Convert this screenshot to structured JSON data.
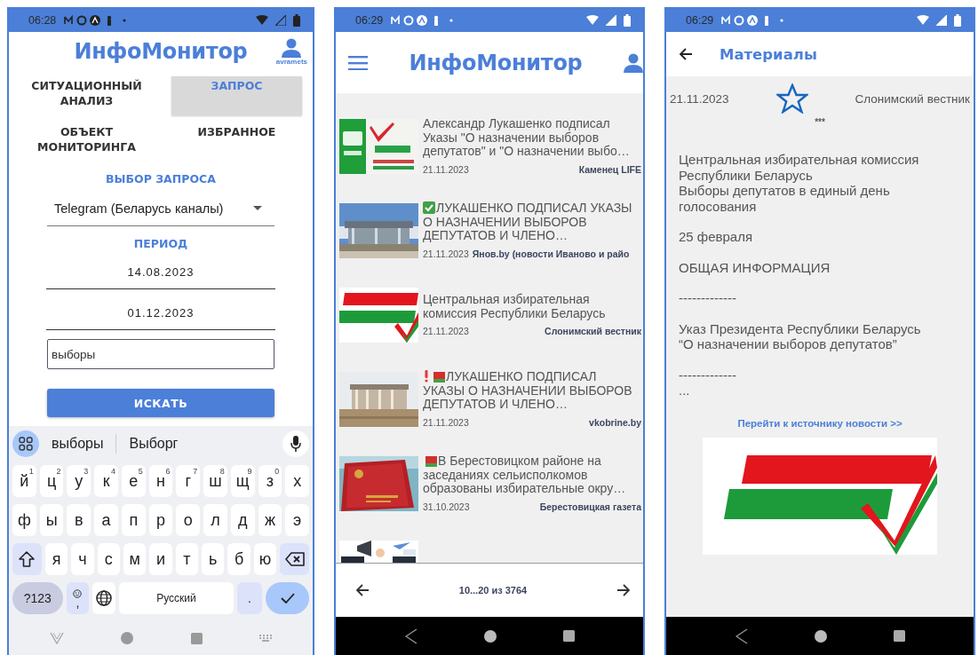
{
  "query_screen": {
    "status_bar": {
      "time": "06:28"
    },
    "header": {
      "title": "ИнфоМонитор",
      "user": "avramets"
    },
    "tabs": [
      {
        "label": "СИТУАЦИОННЫЙ АНАЛИЗ",
        "selected": false
      },
      {
        "label": "ЗАПРОС",
        "selected": true
      },
      {
        "label": "ОБЪЕКТ МОНИТОРИНГА",
        "selected": false
      },
      {
        "label": "ИЗБРАННОЕ",
        "selected": false
      }
    ],
    "request_label": "ВЫБОР ЗАПРОСА",
    "request_select": {
      "value": "Telegram (Беларусь каналы)"
    },
    "period_label": "ПЕРИОД",
    "date_from": {
      "value": "14.08.2023"
    },
    "date_to": {
      "value": "01.12.2023"
    },
    "search_field": {
      "value": "выборы"
    },
    "search_button": "ИСКАТЬ",
    "keyboard": {
      "suggestions": [
        "выборы",
        "Выборг"
      ],
      "letter_rows": [
        {
          "keys": [
            {
              "kind": "char",
              "label": "й",
              "hint": "1"
            },
            {
              "kind": "char",
              "label": "ц",
              "hint": "2"
            },
            {
              "kind": "char",
              "label": "у",
              "hint": "3"
            },
            {
              "kind": "char",
              "label": "к",
              "hint": "4"
            },
            {
              "kind": "char",
              "label": "е",
              "hint": "5"
            },
            {
              "kind": "char",
              "label": "н",
              "hint": "6"
            },
            {
              "kind": "char",
              "label": "г",
              "hint": "7"
            },
            {
              "kind": "char",
              "label": "ш",
              "hint": "8"
            },
            {
              "kind": "char",
              "label": "щ",
              "hint": "9"
            },
            {
              "kind": "char",
              "label": "з",
              "hint": "0"
            },
            {
              "kind": "char",
              "label": "х"
            }
          ]
        },
        {
          "keys": [
            {
              "kind": "char",
              "label": "ф"
            },
            {
              "kind": "char",
              "label": "ы"
            },
            {
              "kind": "char",
              "label": "в"
            },
            {
              "kind": "char",
              "label": "а"
            },
            {
              "kind": "char",
              "label": "п"
            },
            {
              "kind": "char",
              "label": "р"
            },
            {
              "kind": "char",
              "label": "о"
            },
            {
              "kind": "char",
              "label": "л"
            },
            {
              "kind": "char",
              "label": "д"
            },
            {
              "kind": "char",
              "label": "ж"
            },
            {
              "kind": "char",
              "label": "э"
            }
          ]
        },
        {
          "keys": [
            {
              "kind": "shift"
            },
            {
              "kind": "char",
              "label": "я"
            },
            {
              "kind": "char",
              "label": "ч"
            },
            {
              "kind": "char",
              "label": "с"
            },
            {
              "kind": "char",
              "label": "м"
            },
            {
              "kind": "char",
              "label": "и"
            },
            {
              "kind": "char",
              "label": "т"
            },
            {
              "kind": "char",
              "label": "ь"
            },
            {
              "kind": "char",
              "label": "б"
            },
            {
              "kind": "char",
              "label": "ю"
            },
            {
              "kind": "backspace"
            }
          ]
        }
      ],
      "bottom_row": {
        "keys": [
          {
            "kind": "symbols",
            "label": "?123"
          },
          {
            "kind": "emoji",
            "label": ","
          },
          {
            "kind": "globe"
          },
          {
            "kind": "space",
            "label": "Русский"
          },
          {
            "kind": "period",
            "label": "."
          },
          {
            "kind": "enter"
          }
        ]
      }
    }
  },
  "results_screen": {
    "status_bar": {
      "time": "06:29"
    },
    "header": {
      "title": "ИнфоМонитор"
    },
    "items": [
      {
        "image": {
          "kind": "picture"
        },
        "title": "Александр Лукашенко подписал Указы \"О назначении выборов депутатов\" и \"О назначении выбо…",
        "date": "21.11.2023",
        "source": "Каменец LIFE"
      },
      {
        "image": {
          "kind": "picture"
        },
        "badges": [
          {
            "kind": "check"
          }
        ],
        "title": "ЛУКАШЕНКО ПОДПИСАЛ УКАЗЫ О НАЗНАЧЕНИИ ВЫБОРОВ ДЕПУТАТОВ И ЧЛЕНО…",
        "date": "21.11.2023",
        "source": "Янов.by (новости Иваново и райо"
      },
      {
        "image": {
          "kind": "picture"
        },
        "title": "Центральная избирательная комиссия Республики Беларусь",
        "date": "21.11.2023",
        "source": "Слонимский вестник"
      },
      {
        "image": {
          "kind": "picture"
        },
        "badges": [
          {
            "kind": "exclamation"
          },
          {
            "kind": "flag"
          }
        ],
        "title": "ЛУКАШЕНКО ПОДПИСАЛ УКАЗЫ О НАЗНАЧЕНИИ ВЫБОРОВ ДЕПУТАТОВ И ЧЛЕНО…",
        "date": "21.11.2023",
        "source": "vkobrine.by"
      },
      {
        "image": {
          "kind": "picture"
        },
        "badges": [
          {
            "kind": "flag"
          }
        ],
        "title": "В Берестовицком районе на заседаниях сельисполкомов образованы избирательные окру…",
        "date": "31.10.2023",
        "source": "Берестовицкая газета"
      },
      {
        "image": {
          "kind": "picture"
        }
      }
    ],
    "pager": {
      "label": "10...20 из 3764"
    }
  },
  "article_screen": {
    "status_bar": {
      "time": "06:29"
    },
    "header": {
      "title": "Материалы"
    },
    "date": "21.11.2023",
    "favorite": false,
    "source": "Слонимский вестник",
    "separator": "***",
    "paragraphs": [
      "Центральная избирательная комиссия Республики Беларусь\nВыборы депутатов в единый день голосования",
      "25 февраля",
      "ОБЩАЯ ИНФОРМАЦИЯ",
      "-------------",
      "Указ Президента Республики Беларусь “О назначении выборов депутатов”",
      "-------------\n..."
    ],
    "source_link": "Перейти к источнику новости >>",
    "image": {
      "kind": "picture"
    }
  }
}
